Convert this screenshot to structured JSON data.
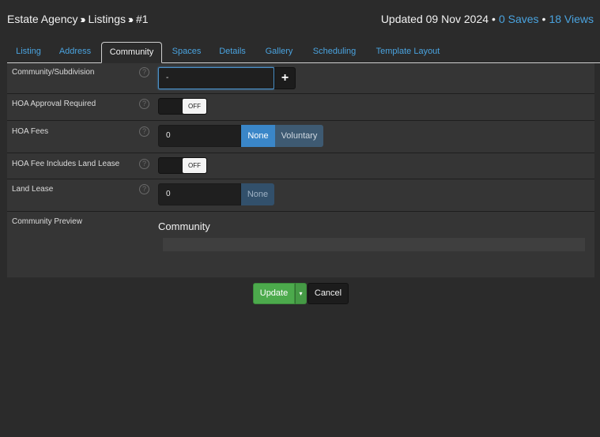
{
  "breadcrumb": {
    "root": "Estate Agency",
    "section": "Listings",
    "item": "#1"
  },
  "meta": {
    "updated": "Updated 09 Nov 2024",
    "saves": "0 Saves",
    "views": "18 Views"
  },
  "tabs": [
    {
      "label": "Listing"
    },
    {
      "label": "Address"
    },
    {
      "label": "Community"
    },
    {
      "label": "Spaces"
    },
    {
      "label": "Details"
    },
    {
      "label": "Gallery"
    },
    {
      "label": "Scheduling"
    },
    {
      "label": "Template Layout"
    }
  ],
  "active_tab": "Community",
  "form": {
    "community": {
      "label": "Community/Subdivision",
      "value": "-",
      "add_label": "+"
    },
    "hoa_approval": {
      "label": "HOA Approval Required",
      "state": "OFF"
    },
    "hoa_fees": {
      "label": "HOA Fees",
      "value": "0",
      "options": [
        "None",
        "Voluntary"
      ],
      "selected": "None"
    },
    "hoa_land_lease": {
      "label": "HOA Fee Includes Land Lease",
      "state": "OFF"
    },
    "land_lease": {
      "label": "Land Lease",
      "value": "0",
      "option": "None"
    },
    "preview": {
      "label": "Community Preview",
      "title": "Community"
    }
  },
  "actions": {
    "update": "Update",
    "caret": "▾",
    "cancel": "Cancel"
  },
  "help_glyph": "?",
  "colors": {
    "link": "#4aa3df",
    "primary": "#3a86c8",
    "success": "#4caa4c",
    "background": "#2b2b2b"
  }
}
